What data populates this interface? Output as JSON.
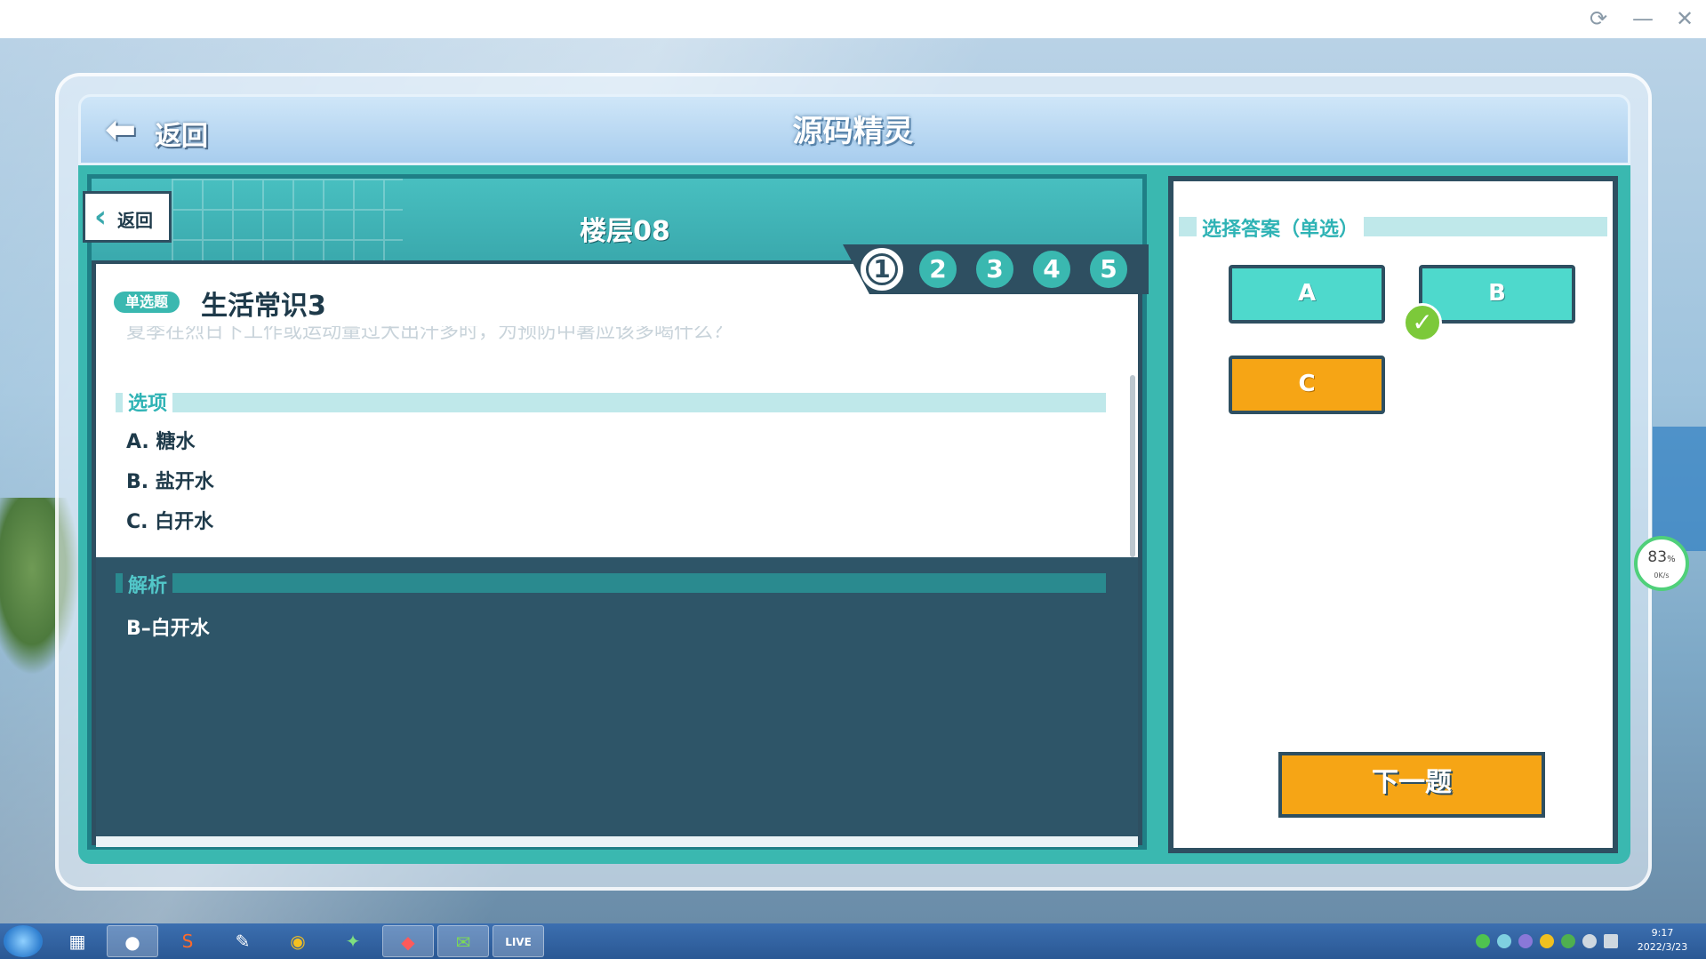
{
  "window": {
    "controls": [
      "refresh-icon",
      "minimize-icon",
      "close-icon"
    ]
  },
  "header": {
    "back_label": "返回",
    "title": "源码精灵"
  },
  "quiz": {
    "floor_title": "楼层08",
    "back_label": "返回",
    "steps": [
      "1",
      "2",
      "3",
      "4",
      "5"
    ],
    "active_step": 1,
    "question_type": "单选题",
    "question_title": "生活常识3",
    "question_text": "夏季在烈日下工作或运动量过大出汗多时，为预防中暑应该多喝什么？",
    "options_label": "选项",
    "options": [
      "A. 糖水",
      "B. 盐开水",
      "C. 白开水"
    ],
    "analysis_label": "解析",
    "analysis_text": "B–白开水"
  },
  "answers": {
    "label": "选择答案（单选）",
    "buttons": [
      {
        "label": "A",
        "color": "#4ed9cc"
      },
      {
        "label": "B",
        "color": "#4ed9cc",
        "correct": true
      },
      {
        "label": "C",
        "color": "#f6a515",
        "selected": true
      }
    ],
    "next_label": "下一题"
  },
  "perf_widget": {
    "percent": "83",
    "unit": "%",
    "speed": "0K/s"
  },
  "taskbar": {
    "apps": [
      "calculator",
      "penguin-game",
      "sogou",
      "feather-tool",
      "chrome",
      "browser-game",
      "game-app",
      "wechat",
      "live"
    ],
    "live_label": "LIVE",
    "time": "9:17",
    "date": "2022/3/23"
  },
  "colors": {
    "accent": "#3ab8b0",
    "dark": "#2e4f61",
    "orange": "#f6a515",
    "correct": "#7cc93a"
  }
}
